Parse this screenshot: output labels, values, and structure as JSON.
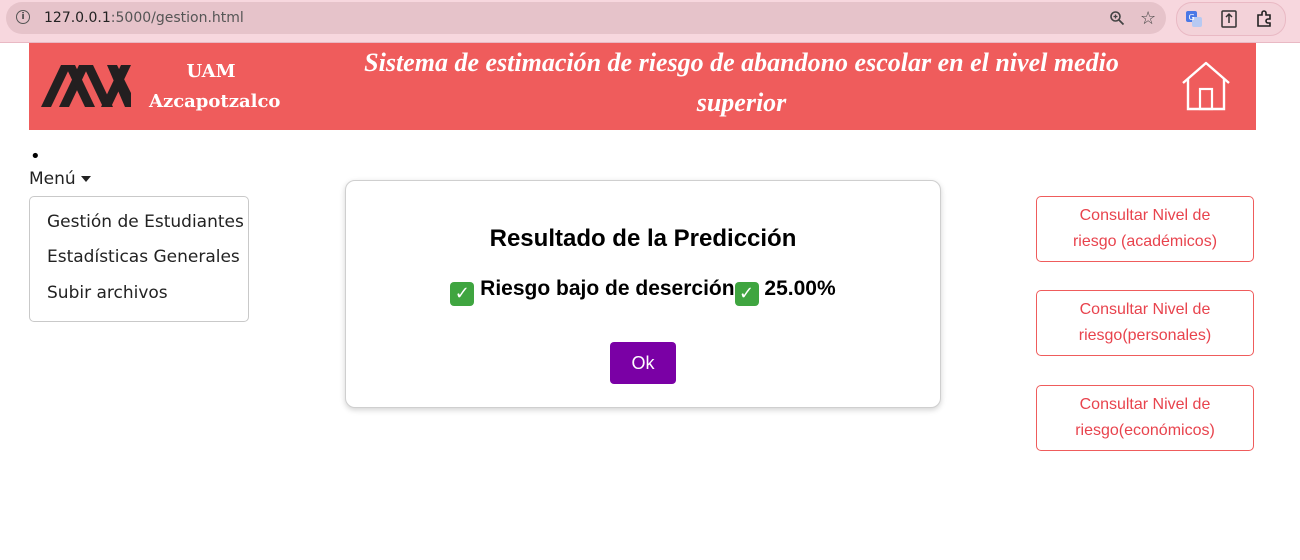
{
  "browser": {
    "url_host": "127.0.0.1",
    "url_path": ":5000/gestion.html"
  },
  "header": {
    "org_line1": "UAM",
    "org_line2": "Azcapotzalco",
    "title": "Sistema de estimación de riesgo de abandono escolar en el nivel medio superior",
    "home_icon": "home-icon"
  },
  "menu": {
    "bullet": "•",
    "toggle_label": "Menú",
    "items": [
      {
        "label": "Gestión de Estudiantes"
      },
      {
        "label": "Estadísticas Generales"
      },
      {
        "label": "Subir archivos"
      }
    ]
  },
  "modal": {
    "title": "Resultado de la Predicción",
    "result_text": "Riesgo bajo de deserción",
    "percentage": "25.00%",
    "ok_label": "Ok"
  },
  "risk_buttons": [
    {
      "label": "Consultar Nivel de riesgo (académicos)"
    },
    {
      "label": "Consultar Nivel de riesgo(personales)"
    },
    {
      "label": "Consultar Nivel de riesgo(económicos)"
    }
  ],
  "colors": {
    "header_bg": "#ef5c5c",
    "ok_button": "#7a00a5",
    "risk_button_text": "#e8434d"
  }
}
